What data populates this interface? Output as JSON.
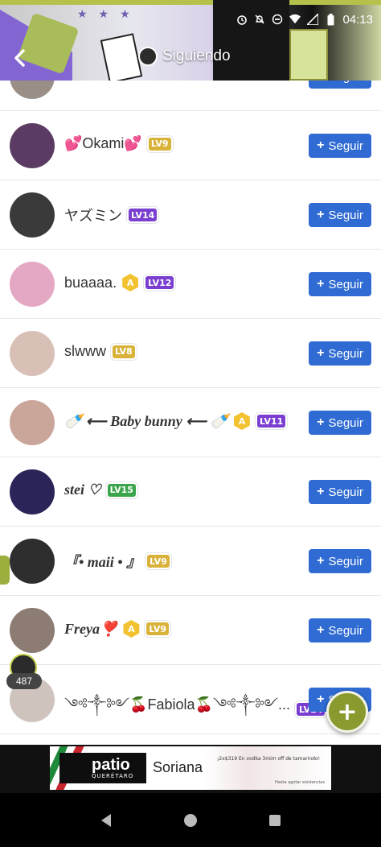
{
  "status_bar": {
    "time": "04:13"
  },
  "header": {
    "title": "Siguiendo"
  },
  "users": [
    {
      "name": "",
      "name_style": "serif",
      "badges": [],
      "avatar_color": "#9a8f86",
      "follow_label": "Seguir"
    },
    {
      "name": "💕Okami💕",
      "name_style": "sans",
      "badges": [
        {
          "type": "lv",
          "text": "LV9",
          "color": "#d9b23a"
        }
      ],
      "avatar_color": "#5b3b63",
      "follow_label": "Seguir"
    },
    {
      "name": "ヤズミン",
      "name_style": "sans",
      "badges": [
        {
          "type": "lv",
          "text": "LV14",
          "color": "#7a3fd0"
        }
      ],
      "avatar_color": "#3a3a3a",
      "follow_label": "Seguir"
    },
    {
      "name": "buaaaa.",
      "name_style": "sans",
      "badges": [
        {
          "type": "hex",
          "text": "A"
        },
        {
          "type": "lv",
          "text": "LV12",
          "color": "#7a3fd0"
        }
      ],
      "avatar_color": "#e5a8c4",
      "follow_label": "Seguir"
    },
    {
      "name": "slwww",
      "name_style": "sans",
      "badges": [
        {
          "type": "lv",
          "text": "LV8",
          "color": "#d9b23a"
        }
      ],
      "avatar_color": "#d8c0b6",
      "follow_label": "Seguir"
    },
    {
      "name": "🍼 ⟵ Baby bunny ⟵ 🍼",
      "name_style": "serif",
      "badges": [
        {
          "type": "hex",
          "text": "A"
        },
        {
          "type": "lv",
          "text": "LV11",
          "color": "#7a3fd0"
        }
      ],
      "avatar_color": "#caa59a",
      "follow_label": "Seguir"
    },
    {
      "name": "stei ♡",
      "name_style": "serif",
      "badges": [
        {
          "type": "lv",
          "text": "LV15",
          "color": "#3aa54a"
        }
      ],
      "avatar_color": "#2a2458",
      "follow_label": "Seguir"
    },
    {
      "name": "『• maii • 』",
      "name_style": "serif",
      "badges": [
        {
          "type": "lv",
          "text": "LV9",
          "color": "#d9b23a"
        }
      ],
      "avatar_color": "#2e2e2e",
      "follow_label": "Seguir"
    },
    {
      "name": "Freya❣️",
      "name_style": "serif",
      "badges": [
        {
          "type": "hex",
          "text": "A"
        },
        {
          "type": "lv",
          "text": "LV9",
          "color": "#d9b23a"
        }
      ],
      "avatar_color": "#8d7c74",
      "follow_label": "Seguir"
    },
    {
      "name": "༺༒༻🍒Fabiola🍒༺༒༻...",
      "name_style": "sans",
      "badges": [
        {
          "type": "lv",
          "text": "LV14",
          "color": "#7a3fd0"
        }
      ],
      "avatar_color": "#cfc3bd",
      "follow_label": "Seguir"
    }
  ],
  "live": {
    "viewer_count": "487"
  },
  "ad": {
    "logo_main": "patio",
    "logo_sub": "QUERÉTARO",
    "brand": "Soriana",
    "text": "¡2x$319 En vodka 3mim off de tamarindo!",
    "fine_print": "Hasta agotar existencias"
  },
  "colors": {
    "accent": "#2f6bd2",
    "fab": "#8a9a2e"
  }
}
